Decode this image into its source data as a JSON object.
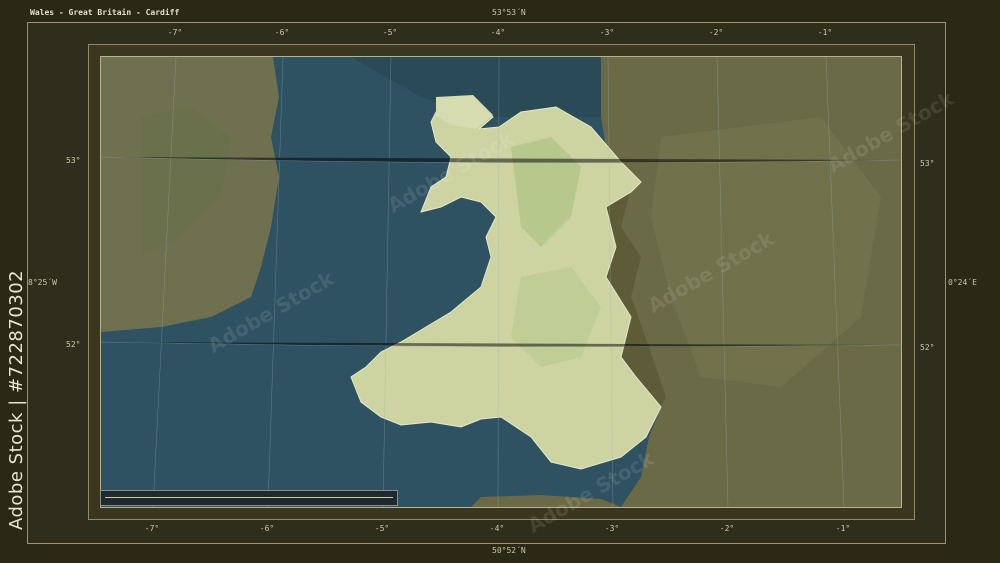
{
  "title": "Wales - Great Britain - Cardiff",
  "top_coord": "53°53´N",
  "bottom_coord": "50°52´N",
  "left_coord": "8°25´W",
  "right_coord": "0°24´E",
  "top_ticks": [
    "-7°",
    "-6°",
    "-5°",
    "-4°",
    "-3°",
    "-2°",
    "-1°"
  ],
  "bottom_ticks": [
    "-7°",
    "-6°",
    "-5°",
    "-4°",
    "-3°",
    "-2°",
    "-1°"
  ],
  "left_lat_ticks": [
    "53°",
    "52°"
  ],
  "right_lat_ticks": [
    "53°",
    "52°"
  ],
  "side_credit": "Adobe Stock | #722870302",
  "watermark_text": "Adobe Stock",
  "colors": {
    "sea": "#2f5060",
    "highlight_land": "#cfd6a6",
    "other_land": "#6e6a48",
    "frame": "#2a2916"
  }
}
